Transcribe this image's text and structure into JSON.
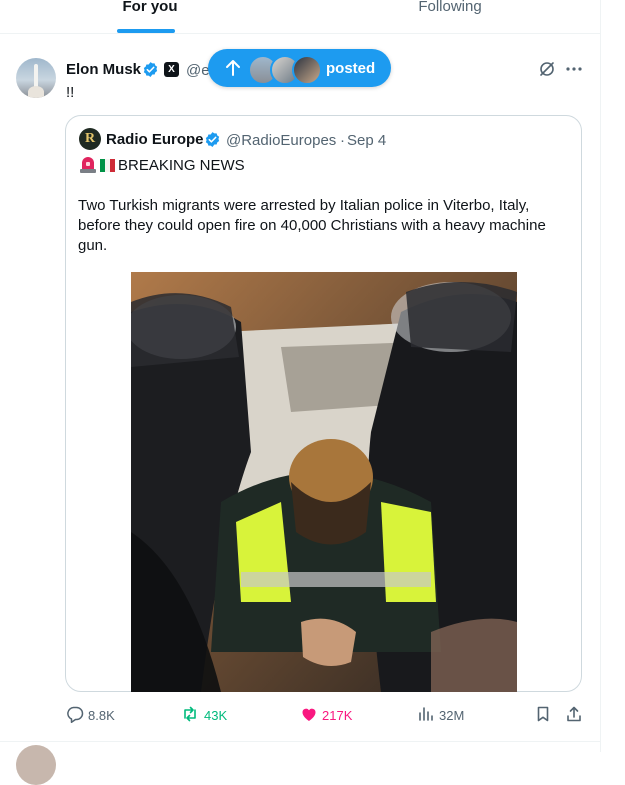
{
  "tabs": [
    {
      "label": "For you",
      "active": true
    },
    {
      "label": "Following",
      "active": false
    }
  ],
  "new_posts_pill": {
    "label": "posted",
    "icon": "arrow-up-icon"
  },
  "tweet": {
    "author_name": "Elon Musk",
    "author_handle": "@el",
    "text": "!!",
    "verified": true,
    "affiliate_badge": "X"
  },
  "quote": {
    "avatar_letter": "R",
    "author_name": "Radio Europe",
    "author_handle": "@RadioEuropes",
    "separator": "·",
    "date": "Sep 4",
    "headline": "BREAKING NEWS",
    "body": "Two Turkish migrants were arrested by Italian police in Viterbo, Italy, before they could open fire on 40,000 Christians with a heavy machine gun."
  },
  "actions": {
    "replies": "8.8K",
    "reposts": "43K",
    "likes": "217K",
    "views": "32M"
  },
  "colors": {
    "accent": "#1d9bf0",
    "repost_green": "#00ba7c",
    "like_pink": "#f91880",
    "muted": "#536471"
  }
}
